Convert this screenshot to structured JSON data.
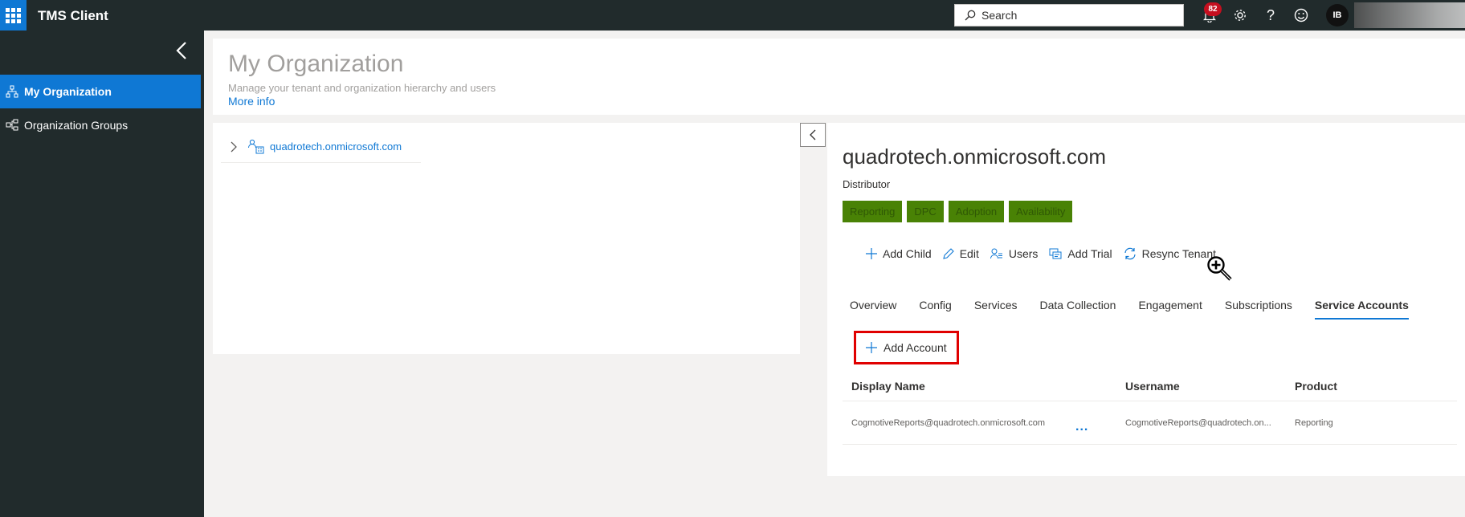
{
  "app": {
    "title": "TMS Client"
  },
  "topbar": {
    "search_placeholder": "Search",
    "notification_count": "82",
    "avatar_initials": "IB"
  },
  "sidebar": {
    "items": [
      {
        "label": "My Organization",
        "icon": "org-tree-icon",
        "active": true
      },
      {
        "label": "Organization Groups",
        "icon": "org-groups-icon",
        "active": false
      }
    ]
  },
  "header": {
    "title": "My Organization",
    "subtitle": "Manage your tenant and organization hierarchy and users",
    "more_info": "More info"
  },
  "tree": {
    "nodes": [
      {
        "label": "quadrotech.onmicrosoft.com",
        "icon": "organization-icon"
      }
    ]
  },
  "detail": {
    "title": "quadrotech.onmicrosoft.com",
    "type": "Distributor",
    "tags": [
      "Reporting",
      "DPC",
      "Adoption",
      "Availability"
    ],
    "commands": [
      {
        "label": "Add Child",
        "icon": "plus-icon"
      },
      {
        "label": "Edit",
        "icon": "pencil-icon"
      },
      {
        "label": "Users",
        "icon": "users-icon"
      },
      {
        "label": "Add Trial",
        "icon": "trial-icon"
      },
      {
        "label": "Resync Tenant",
        "icon": "sync-icon"
      }
    ],
    "tabs": [
      "Overview",
      "Config",
      "Services",
      "Data Collection",
      "Engagement",
      "Subscriptions",
      "Service Accounts"
    ],
    "active_tab": "Service Accounts",
    "add_account_label": "Add Account",
    "table": {
      "columns": [
        "Display Name",
        "Username",
        "Product"
      ],
      "rows": [
        {
          "display_name": "CogmotiveReports@quadrotech.onmicrosoft.com",
          "more": "...",
          "username": "CogmotiveReports@quadrotech.on...",
          "product": "Reporting"
        }
      ]
    }
  },
  "colors": {
    "accent": "#0f78d4",
    "topbar": "#212b2c",
    "tag": "#498205",
    "highlight": "#e00000"
  }
}
